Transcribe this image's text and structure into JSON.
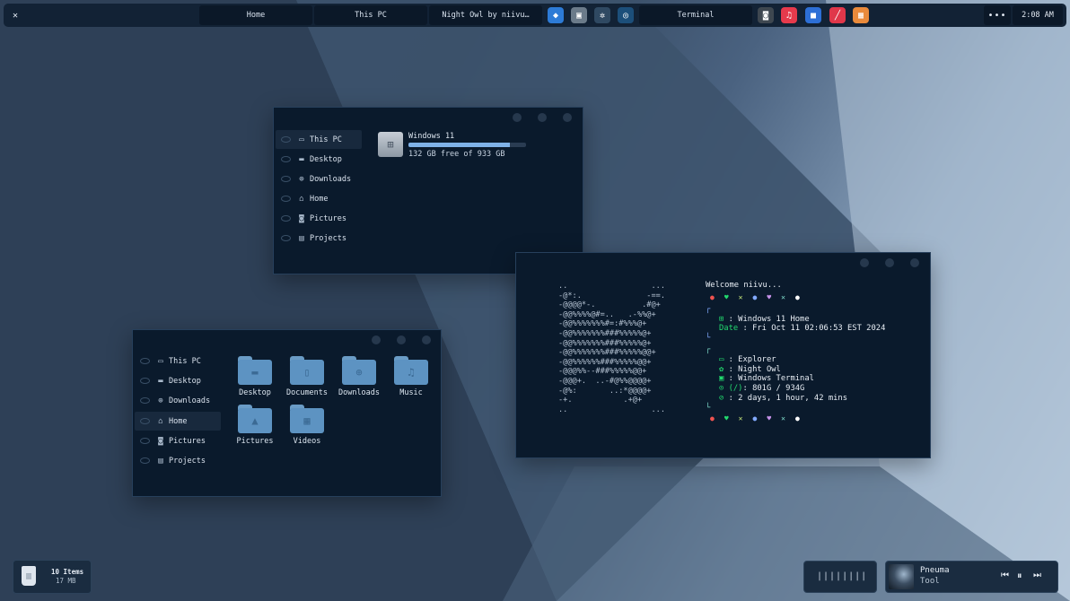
{
  "taskbar": {
    "close_label": "✕",
    "tabs": [
      "Home",
      "This PC",
      "Night Owl by niivu…",
      "Terminal"
    ],
    "apps": [
      {
        "name": "proton-app-icon",
        "glyph": "◆",
        "color": "#2d7bd6"
      },
      {
        "name": "finder-app-icon",
        "glyph": "▣",
        "color": "#6b7b8a"
      },
      {
        "name": "settings-app-icon",
        "glyph": "✲",
        "color": "#2f4962"
      },
      {
        "name": "steam-app-icon",
        "glyph": "◎",
        "color": "#1c4f7a"
      },
      {
        "name": "camera-app-icon",
        "glyph": "◙",
        "color": "#3e4750"
      },
      {
        "name": "music-app-icon",
        "glyph": "♫",
        "color": "#e63a4c"
      },
      {
        "name": "files-app-icon",
        "glyph": "■",
        "color": "#2d6fd6"
      },
      {
        "name": "draw-app-icon",
        "glyph": "╱",
        "color": "#e0374a"
      },
      {
        "name": "grid-app-icon",
        "glyph": "▦",
        "color": "#e98a3b"
      }
    ],
    "more_label": "•••",
    "clock": "2:08 AM"
  },
  "this_pc_window": {
    "sidebar": [
      "This PC",
      "Desktop",
      "Downloads",
      "Home",
      "Pictures",
      "Projects"
    ],
    "drive": {
      "name": "Windows 11",
      "free_text": "132 GB free of 933 GB",
      "used_fraction": 0.86
    }
  },
  "home_window": {
    "sidebar": [
      "This PC",
      "Desktop",
      "Downloads",
      "Home",
      "Pictures",
      "Projects"
    ],
    "folders": [
      "Desktop",
      "Documents",
      "Downloads",
      "Music",
      "Pictures",
      "Videos"
    ]
  },
  "terminal": {
    "art": "..                  ...\n-@*:.              -==.\n-@@@@*-.          .#@+\n-@@%%%%@#=..   .-%%@+\n-@@%%%%%%%#=:#%%%@+\n-@@%%%%%%%###%%%%%@+\n-@@%%%%%%%###%%%%%@+\n-@@%%%%%%%###%%%%%@@+\n-@@%%%%%%###%%%%%@@+\n-@@@%%--###%%%%%@@+\n-@@@+.  ..-#@%%@@@@+\n-@%:       ..:*@@@@+\n-+.           .+@+\n..                  ...",
    "welcome": "Welcome niivu...",
    "os_line": " : Windows 11 Home",
    "date_label": "Date",
    "date_value": " : Fri Oct 11 02:06:53 EST 2024",
    "shell_line": " : Explorer",
    "theme_line": " : Night Owl",
    "term_line": " : Windows Terminal",
    "disk_label": " (/)",
    "disk_value": ": 801G / 934G",
    "uptime_line": " : 2 days, 1 hour, 42 mins",
    "palette_glyphs": [
      "●",
      "♥",
      "✕",
      "●",
      "♥",
      "✕",
      "●"
    ],
    "palette_colors": [
      "#ef5350",
      "#22da6e",
      "#c5e478",
      "#82aaff",
      "#c792ea",
      "#7fdbca",
      "#ffffff"
    ]
  },
  "trash": {
    "count": "10 Items",
    "size": "17 MB"
  },
  "visualizer": {
    "bars": "||||||||"
  },
  "media": {
    "title": "Pneuma",
    "artist": "Tool"
  }
}
